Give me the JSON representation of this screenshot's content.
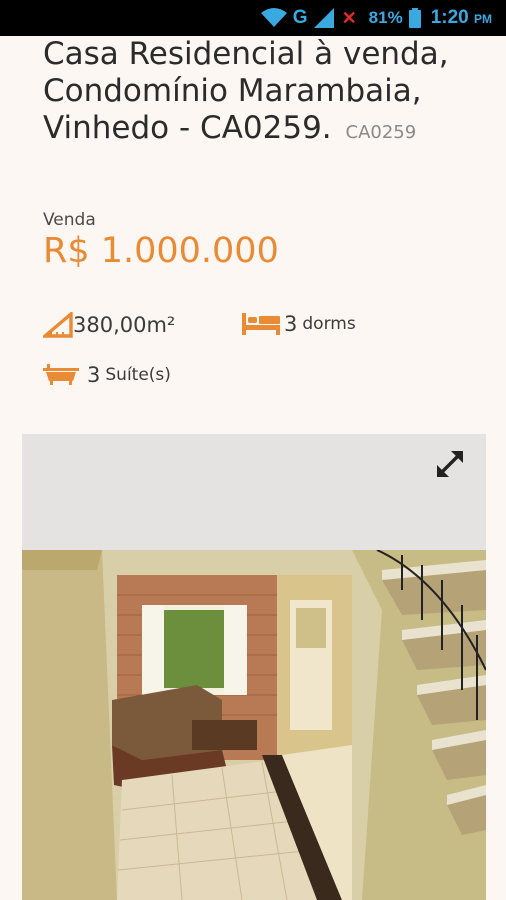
{
  "status_bar": {
    "network_label": "G",
    "battery_percent": "81%",
    "time": "1:20",
    "time_suffix": "PM",
    "icons": [
      "wifi-icon",
      "signal-icon",
      "no-sim-icon",
      "battery-icon"
    ]
  },
  "listing": {
    "title": "Casa Residencial à venda, Condomínio Marambaia, Vinhedo - CA0259.",
    "code": "CA0259",
    "transaction_label": "Venda",
    "price": "R$ 1.000.000",
    "features": {
      "area": "380,00m²",
      "dorms_count": "3",
      "dorms_label": "dorms",
      "suites_count": "3",
      "suites_label": "Suíte(s)"
    }
  },
  "gallery": {
    "expand_icon": "expand-icon"
  },
  "colors": {
    "accent": "#e98a35",
    "background": "#fcf7f2",
    "text": "#2b2b2b",
    "status_icon": "#3aa9e0"
  }
}
